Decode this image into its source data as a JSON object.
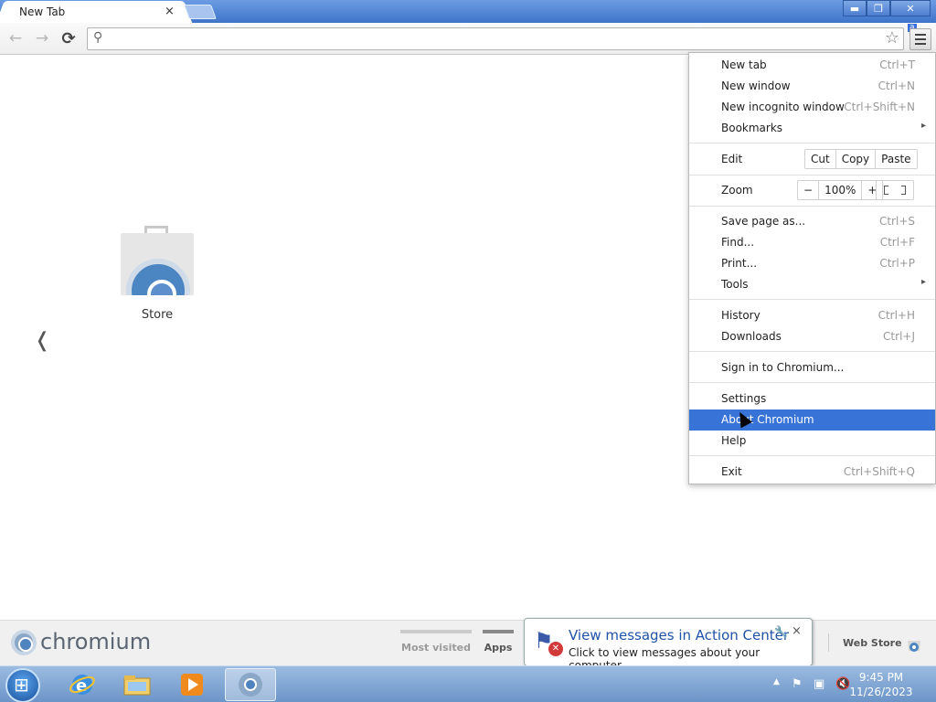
{
  "browser": {
    "tab_title": "New Tab",
    "tab_close": "×",
    "profile_badge": "a"
  },
  "window_controls": {
    "minimize": "▬",
    "maximize": "❐",
    "close": "✕"
  },
  "toolbar": {
    "back_icon": "←",
    "forward_icon": "→",
    "reload_icon": "⟳",
    "search_icon": "⚲",
    "star_icon": "☆",
    "omnibox_value": ""
  },
  "content": {
    "store_label": "Store",
    "prev_arrow": "❬"
  },
  "ntp_bar": {
    "brand": "chromium",
    "tabs": [
      "Most visited",
      "Apps"
    ],
    "webstore_label": "Web Store"
  },
  "menu": {
    "items": [
      {
        "label": "New tab",
        "shortcut": "Ctrl+T"
      },
      {
        "label": "New window",
        "shortcut": "Ctrl+N"
      },
      {
        "label": "New incognito window",
        "shortcut": "Ctrl+Shift+N"
      },
      {
        "label": "Bookmarks",
        "shortcut": ""
      },
      {
        "label": "Edit",
        "shortcut": ""
      },
      {
        "label": "Zoom",
        "shortcut": ""
      },
      {
        "label": "Save page as...",
        "shortcut": "Ctrl+S"
      },
      {
        "label": "Find...",
        "shortcut": "Ctrl+F"
      },
      {
        "label": "Print...",
        "shortcut": "Ctrl+P"
      },
      {
        "label": "Tools",
        "shortcut": ""
      },
      {
        "label": "History",
        "shortcut": "Ctrl+H"
      },
      {
        "label": "Downloads",
        "shortcut": "Ctrl+J"
      },
      {
        "label": "Sign in to Chromium...",
        "shortcut": ""
      },
      {
        "label": "Settings",
        "shortcut": ""
      },
      {
        "label": "About Chromium",
        "shortcut": ""
      },
      {
        "label": "Help",
        "shortcut": ""
      },
      {
        "label": "Exit",
        "shortcut": "Ctrl+Shift+Q"
      }
    ],
    "edit_buttons": [
      "Cut",
      "Copy",
      "Paste"
    ],
    "zoom": {
      "minus": "−",
      "value": "100%",
      "plus": "+"
    },
    "submenu_arrow": "▸",
    "highlighted": "About Chromium"
  },
  "toast": {
    "title": "View messages in Action Center",
    "body": "Click to view messages about your computer.",
    "close": "×",
    "pin": "🔧"
  },
  "taskbar": {
    "time": "9:45 PM",
    "date": "11/26/2023",
    "tray_up_icon": "▲"
  },
  "colors": {
    "menu_highlight": "#3874d8",
    "titlebar": "#4a7fd3",
    "toast_title": "#1f52a8"
  }
}
